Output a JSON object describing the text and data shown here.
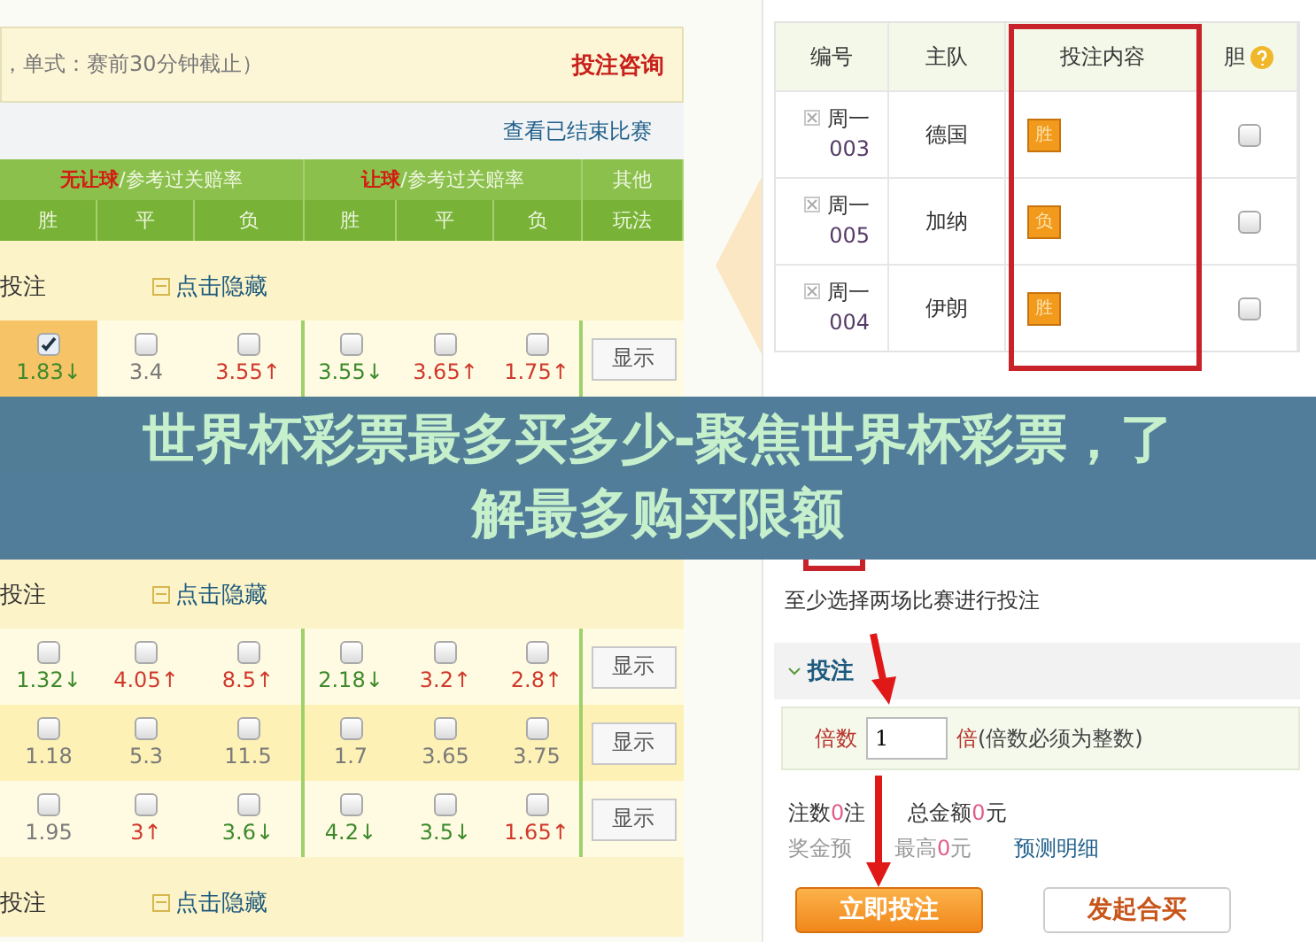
{
  "info_bar": {
    "text": "，单式：赛前30分钟截止）",
    "link": "投注咨询"
  },
  "ended_link": "查看已结束比赛",
  "odds_header": {
    "groups": [
      {
        "highlight": "无让球",
        "rest": "/参考过关赔率"
      },
      {
        "highlight": "让球",
        "rest": "/参考过关赔率"
      }
    ],
    "other": "其他",
    "sub": [
      "胜",
      "平",
      "负",
      "胜",
      "平",
      "负"
    ],
    "other_sub": "玩法"
  },
  "match_groups": [
    {
      "label": "投注",
      "toggle": "点击隐藏",
      "rows": [
        {
          "kind": "odds",
          "button": "显示",
          "cells": [
            {
              "odds": "1.83↓",
              "color": "#3d8a2c",
              "checked": true
            },
            {
              "odds": "3.4",
              "color": "#7a7a7a",
              "checked": false
            },
            {
              "odds": "3.55↑",
              "color": "#cf3a2c",
              "checked": false
            },
            {
              "odds": "3.55↓",
              "color": "#3d8a2c",
              "checked": false
            },
            {
              "odds": "3.65↑",
              "color": "#cf3a2c",
              "checked": false
            },
            {
              "odds": "1.75↑",
              "color": "#cf3a2c",
              "checked": false
            }
          ]
        },
        {
          "kind": "covered"
        },
        {
          "kind": "covered"
        }
      ]
    },
    {
      "label": "投注",
      "toggle": "点击隐藏",
      "rows": [
        {
          "kind": "odds",
          "button": "显示",
          "cells": [
            {
              "odds": "1.32↓",
              "color": "#3d8a2c",
              "checked": false
            },
            {
              "odds": "4.05↑",
              "color": "#cf3a2c",
              "checked": false
            },
            {
              "odds": "8.5↑",
              "color": "#cf3a2c",
              "checked": false
            },
            {
              "odds": "2.18↓",
              "color": "#3d8a2c",
              "checked": false
            },
            {
              "odds": "3.2↑",
              "color": "#cf3a2c",
              "checked": false
            },
            {
              "odds": "2.8↑",
              "color": "#cf3a2c",
              "checked": false
            }
          ]
        },
        {
          "kind": "odds",
          "button": "显示",
          "cells": [
            {
              "odds": "1.18",
              "color": "#7a7a7a",
              "checked": false
            },
            {
              "odds": "5.3",
              "color": "#7a7a7a",
              "checked": false
            },
            {
              "odds": "11.5",
              "color": "#7a7a7a",
              "checked": false
            },
            {
              "odds": "1.7",
              "color": "#7a7a7a",
              "checked": false
            },
            {
              "odds": "3.65",
              "color": "#7a7a7a",
              "checked": false
            },
            {
              "odds": "3.75",
              "color": "#7a7a7a",
              "checked": false
            }
          ]
        },
        {
          "kind": "odds",
          "button": "显示",
          "cells": [
            {
              "odds": "1.95",
              "color": "#7a7a7a",
              "checked": false
            },
            {
              "odds": "3↑",
              "color": "#cf3a2c",
              "checked": false
            },
            {
              "odds": "3.6↓",
              "color": "#3d8a2c",
              "checked": false
            },
            {
              "odds": "4.2↓",
              "color": "#3d8a2c",
              "checked": false
            },
            {
              "odds": "3.5↓",
              "color": "#3d8a2c",
              "checked": false
            },
            {
              "odds": "1.65↑",
              "color": "#cf3a2c",
              "checked": false
            }
          ]
        }
      ]
    },
    {
      "label": "投注",
      "toggle": "点击隐藏"
    }
  ],
  "slip": {
    "columns": [
      "编号",
      "主队",
      "投注内容",
      "胆"
    ],
    "rows": [
      {
        "day": "周一",
        "num": "003",
        "team": "德国",
        "pick": "胜",
        "banker": false
      },
      {
        "day": "周一",
        "num": "005",
        "team": "加纳",
        "pick": "负",
        "banker": false
      },
      {
        "day": "周一",
        "num": "004",
        "team": "伊朗",
        "pick": "胜",
        "banker": false
      }
    ]
  },
  "hint": "至少选择两场比赛进行投注",
  "bet_section": {
    "title": "投注",
    "multiplier_label": "倍数",
    "multiplier": "1",
    "unit": "倍",
    "note": "(倍数必须为整数)"
  },
  "summary": [
    {
      "label": "注数",
      "value": "0",
      "unit": "注"
    },
    {
      "label": "总金额",
      "value": "0",
      "unit": "元"
    }
  ],
  "prize": {
    "label": "奖金预",
    "max_label": "最高",
    "max_value": "0",
    "max_unit": "元",
    "link": "预测明细"
  },
  "buttons": [
    {
      "label": "立即投注",
      "kind": "primary"
    },
    {
      "label": "发起合买",
      "kind": "secondary"
    }
  ],
  "banner": {
    "title": "世界杯彩票最多买多少-聚焦世界杯彩票，了解最多购买限额"
  }
}
